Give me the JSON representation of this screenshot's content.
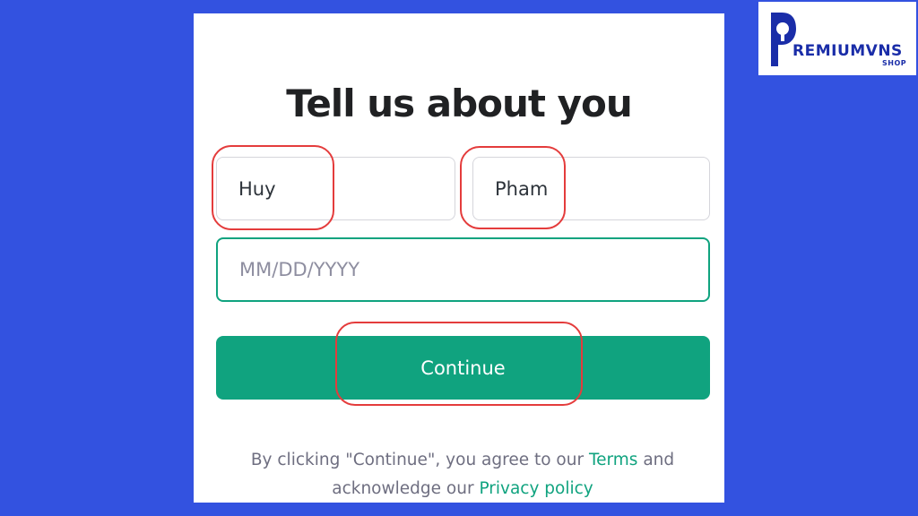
{
  "form": {
    "title": "Tell us about you",
    "first_name": "Huy",
    "last_name": "Pham",
    "birthday_placeholder": "MM/DD/YYYY",
    "continue_label": "Continue"
  },
  "legal": {
    "prefix": "By clicking \"Continue\", you agree to our ",
    "terms_link": "Terms",
    "middle": " and acknowledge our ",
    "privacy_link": "Privacy policy"
  },
  "logo": {
    "name": "REMIUMVNS",
    "sub": "SHOP"
  },
  "colors": {
    "background": "#3352e0",
    "accent": "#10a37f",
    "annotation": "#e43c3c",
    "logo": "#1a2da8"
  }
}
